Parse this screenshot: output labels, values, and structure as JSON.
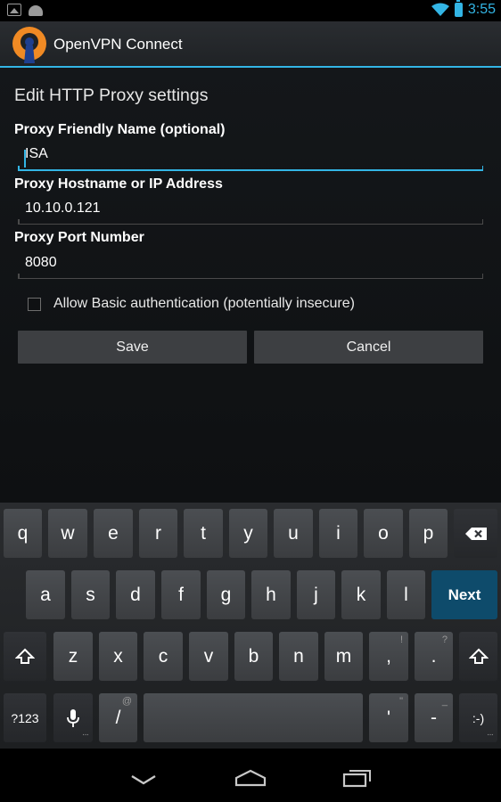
{
  "status_bar": {
    "time": "3:55"
  },
  "action_bar": {
    "title": "OpenVPN Connect"
  },
  "form": {
    "title": "Edit HTTP Proxy settings",
    "friendly_name_label": "Proxy Friendly Name (optional)",
    "friendly_name_value": "ISA",
    "hostname_label": "Proxy Hostname or IP Address",
    "hostname_value": "10.10.0.121",
    "port_label": "Proxy Port Number",
    "port_value": "8080",
    "basic_auth_label": "Allow Basic authentication (potentially insecure)",
    "basic_auth_checked": false,
    "save_label": "Save",
    "cancel_label": "Cancel"
  },
  "keyboard": {
    "row1": [
      "q",
      "w",
      "e",
      "r",
      "t",
      "y",
      "u",
      "i",
      "o",
      "p"
    ],
    "row2": [
      "a",
      "s",
      "d",
      "f",
      "g",
      "h",
      "j",
      "k",
      "l"
    ],
    "next_label": "Next",
    "row3": [
      "z",
      "x",
      "c",
      "v",
      "b",
      "n",
      "m"
    ],
    "comma": ",",
    "comma_hint": "!",
    "period": ".",
    "period_hint": "?",
    "symbols_label": "?123",
    "slash": "/",
    "slash_hint": "@",
    "apostrophe": "'",
    "apostrophe_hint": "\"",
    "dash": "-",
    "dash_hint": "_",
    "smiley": ":-)"
  },
  "colors": {
    "accent": "#33b5e5",
    "next_key": "#0e4b6b",
    "key": "#45484b"
  }
}
